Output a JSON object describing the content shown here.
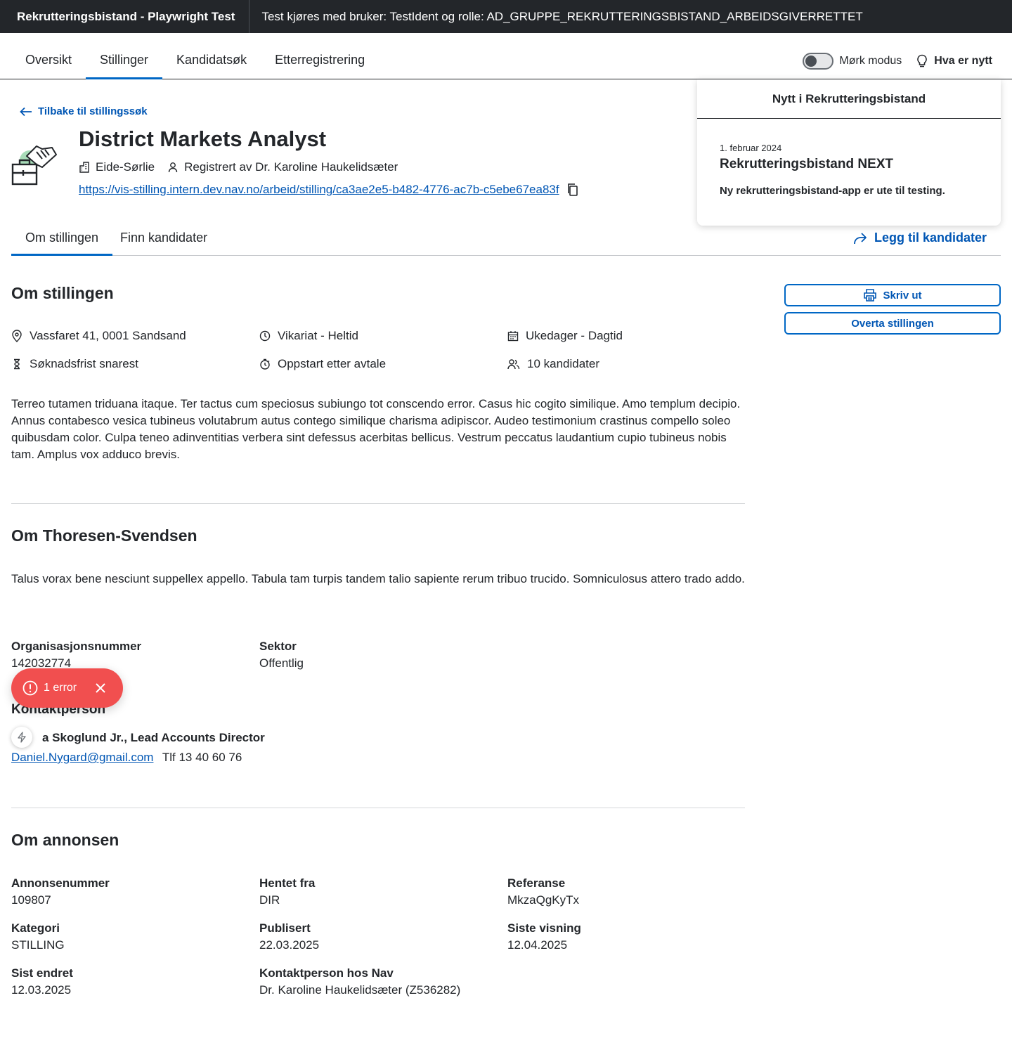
{
  "topbar": {
    "app_title": "Rekrutteringsbistand - Playwright Test",
    "test_info": "Test kjøres med bruker: TestIdent og rolle: AD_GRUPPE_REKRUTTERINGSBISTAND_ARBEIDSGIVERRETTET"
  },
  "nav": {
    "tabs": [
      {
        "label": "Oversikt"
      },
      {
        "label": "Stillinger",
        "active": true
      },
      {
        "label": "Kandidatsøk"
      },
      {
        "label": "Etterregistrering"
      }
    ],
    "dark_mode_label": "Mørk modus",
    "news_label": "Hva er nytt"
  },
  "news_popover": {
    "heading": "Nytt i Rekrutteringsbistand",
    "date": "1. februar 2024",
    "title": "Rekrutteringsbistand NEXT",
    "text": "Ny rekrutteringsbistand-app er ute til testing."
  },
  "header": {
    "back_label": "Tilbake til stillingssøk",
    "title": "District Markets Analyst",
    "employer": "Eide-Sørlie",
    "registered_by": "Registrert av Dr. Karoline Haukelidsæter",
    "url": "https://vis-stilling.intern.dev.nav.no/arbeid/stilling/ca3ae2e5-b482-4776-ac7b-c5ebe67ea83f"
  },
  "subtabs": {
    "about": "Om stillingen",
    "find": "Finn kandidater",
    "add_candidates": "Legg til kandidater"
  },
  "actions": {
    "print": "Skriv ut",
    "take_over": "Overta stillingen"
  },
  "about_job": {
    "heading": "Om stillingen",
    "facts": {
      "address": "Vassfaret 41, 0001 Sandsand",
      "employment": "Vikariat - Heltid",
      "workdays": "Ukedager - Dagtid",
      "deadline": "Søknadsfrist snarest",
      "start": "Oppstart etter avtale",
      "candidates": "10 kandidater"
    },
    "description": "Terreo tutamen triduana itaque. Ter tactus cum speciosus subiungo tot conscendo error. Casus hic cogito similique. Amo templum decipio. Annus contabesco vesica tubineus volutabrum autus contego similique charisma adipiscor. Audeo testimonium crastinus compello soleo quibusdam color. Culpa teneo adinventitias verbera sint defessus acerbitas bellicus. Vestrum peccatus laudantium cupio tubineus nobis tam. Amplus vox adduco brevis."
  },
  "about_employer": {
    "heading": "Om Thoresen-Svendsen",
    "description": "Talus vorax bene nesciunt suppellex appello. Tabula tam turpis tandem talio sapiente rerum tribuo trucido. Somniculosus attero trado addo.",
    "org_label": "Organisasjonsnummer",
    "org_value": "142032774",
    "sector_label": "Sektor",
    "sector_value": "Offentlig",
    "contact_heading": "Kontaktperson",
    "contact_name": "a Skoglund Jr., Lead Accounts Director",
    "contact_email": "Daniel.Nygard@gmail.com",
    "contact_phone": "Tlf 13 40 60 76"
  },
  "about_ad": {
    "heading": "Om annonsen",
    "fields": {
      "ad_number": {
        "label": "Annonsenummer",
        "value": "109807"
      },
      "source": {
        "label": "Hentet fra",
        "value": "DIR"
      },
      "reference": {
        "label": "Referanse",
        "value": "MkzaQgKyTx"
      },
      "category": {
        "label": "Kategori",
        "value": "STILLING"
      },
      "published": {
        "label": "Publisert",
        "value": "22.03.2025"
      },
      "last_view": {
        "label": "Siste visning",
        "value": "12.04.2025"
      },
      "last_changed": {
        "label": "Sist endret",
        "value": "12.03.2025"
      },
      "nav_contact": {
        "label": "Kontaktperson hos Nav",
        "value": "Dr. Karoline Haukelidsæter (Z536282)"
      }
    }
  },
  "error_toast": {
    "text": "1 error"
  },
  "colors": {
    "topbar": "#23262a",
    "accent": "#0067c5",
    "link": "#0056b4",
    "error": "#f14f4f"
  }
}
